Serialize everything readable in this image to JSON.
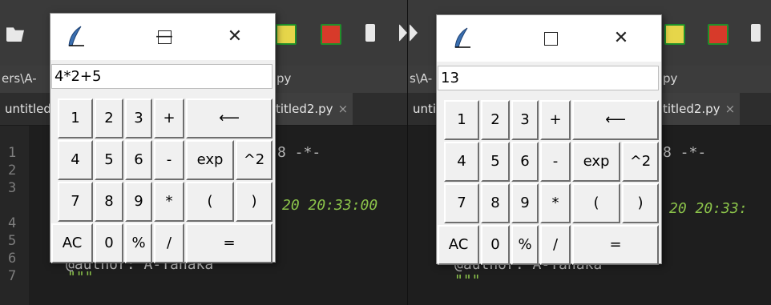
{
  "left_ide": {
    "path_text": "ers\\A-",
    "path_suffix": "py",
    "tabs": [
      {
        "label": "untitled"
      },
      {
        "label": "titled2.py",
        "close": "×"
      }
    ],
    "line_numbers": [
      "1",
      "2",
      "3",
      "4",
      "5",
      "6",
      "7"
    ],
    "code_line1": "8 -*-",
    "code_line3": "20 20:33:00",
    "code_line5": "@author: A-Tanaka",
    "code_line6": "\"\"\""
  },
  "right_ide": {
    "path_text": "s\\A-",
    "path_suffix": "py",
    "tabs": [
      {
        "label": "untitled"
      },
      {
        "label": "titled2.py",
        "close": "×"
      }
    ],
    "code_line1": "8 -*-",
    "code_line3": "20 20:33:",
    "code_line5": "@author: A-Tanaka",
    "code_line6": "\"\"\""
  },
  "calculators": [
    {
      "display_value": "4*2+5",
      "minimize_glyph": "—",
      "maximize_glyph": "□",
      "close_glyph": "✕",
      "keys": {
        "k1": "1",
        "k2": "2",
        "k3": "3",
        "plus": "+",
        "back": "⟵",
        "k4": "4",
        "k5": "5",
        "k6": "6",
        "minus": "-",
        "exp": "exp",
        "pow": "^2",
        "k7": "7",
        "k8": "8",
        "k9": "9",
        "mul": "*",
        "lparen": "(",
        "rparen": ")",
        "ac": "AC",
        "k0": "0",
        "pct": "%",
        "div": "/",
        "eq": "="
      }
    },
    {
      "display_value": "13",
      "minimize_glyph": "—",
      "maximize_glyph": "□",
      "close_glyph": "✕",
      "keys": {
        "k1": "1",
        "k2": "2",
        "k3": "3",
        "plus": "+",
        "back": "⟵",
        "k4": "4",
        "k5": "5",
        "k6": "6",
        "minus": "-",
        "exp": "exp",
        "pow": "^2",
        "k7": "7",
        "k8": "8",
        "k9": "9",
        "mul": "*",
        "lparen": "(",
        "rparen": ")",
        "ac": "AC",
        "k0": "0",
        "pct": "%",
        "div": "/",
        "eq": "="
      }
    }
  ]
}
